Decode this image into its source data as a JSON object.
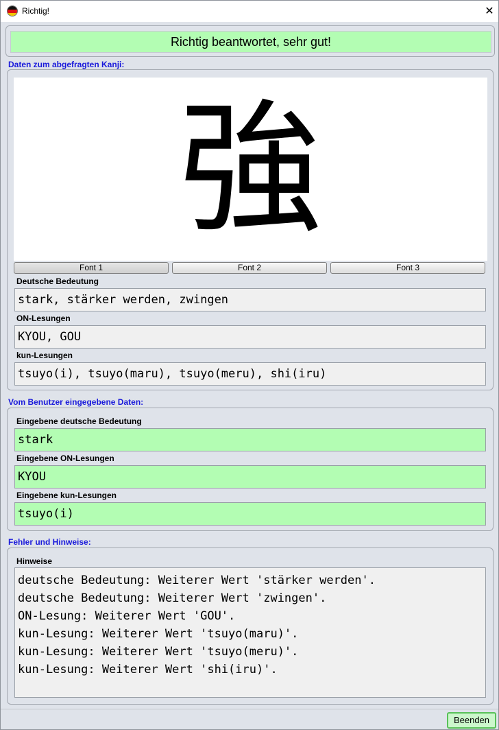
{
  "window": {
    "title": "Richtig!",
    "close_glyph": "✕",
    "icon": "japan-germany-flag-icon"
  },
  "banner": {
    "text": "Richtig beantwortet, sehr gut!",
    "color": "#b3fdb3"
  },
  "kanji_section": {
    "title": "Daten zum abgefragten Kanji:",
    "kanji": "強",
    "font_buttons": [
      "Font 1",
      "Font 2",
      "Font 3"
    ],
    "selected_font": "Font 1",
    "fields": [
      {
        "label": "Deutsche Bedeutung",
        "value": "stark, stärker werden, zwingen"
      },
      {
        "label": "ON-Lesungen",
        "value": "KYOU, GOU"
      },
      {
        "label": "kun-Lesungen",
        "value": "tsuyo(i), tsuyo(maru), tsuyo(meru), shi(iru)"
      }
    ]
  },
  "user_section": {
    "title": "Vom Benutzer eingegebene Daten:",
    "fields": [
      {
        "label": "Eingebene deutsche Bedeutung",
        "value": "stark"
      },
      {
        "label": "Eingebene ON-Lesungen",
        "value": "KYOU"
      },
      {
        "label": "Eingebene kun-Lesungen",
        "value": "tsuyo(i)"
      }
    ],
    "correct_color": "#b3fdb3"
  },
  "notes_section": {
    "title": "Fehler und Hinweise:",
    "label": "Hinweise",
    "lines": [
      "deutsche Bedeutung: Weiterer Wert 'stärker werden'.",
      "deutsche Bedeutung: Weiterer Wert 'zwingen'.",
      "ON-Lesung: Weiterer Wert 'GOU'.",
      "kun-Lesung: Weiterer Wert 'tsuyo(maru)'.",
      "kun-Lesung: Weiterer Wert 'tsuyo(meru)'.",
      "kun-Lesung: Weiterer Wert 'shi(iru)'."
    ]
  },
  "footer": {
    "quit_label": "Beenden"
  },
  "colors": {
    "section_title": "#1a1adb",
    "window_bg": "#dfe3ea"
  }
}
